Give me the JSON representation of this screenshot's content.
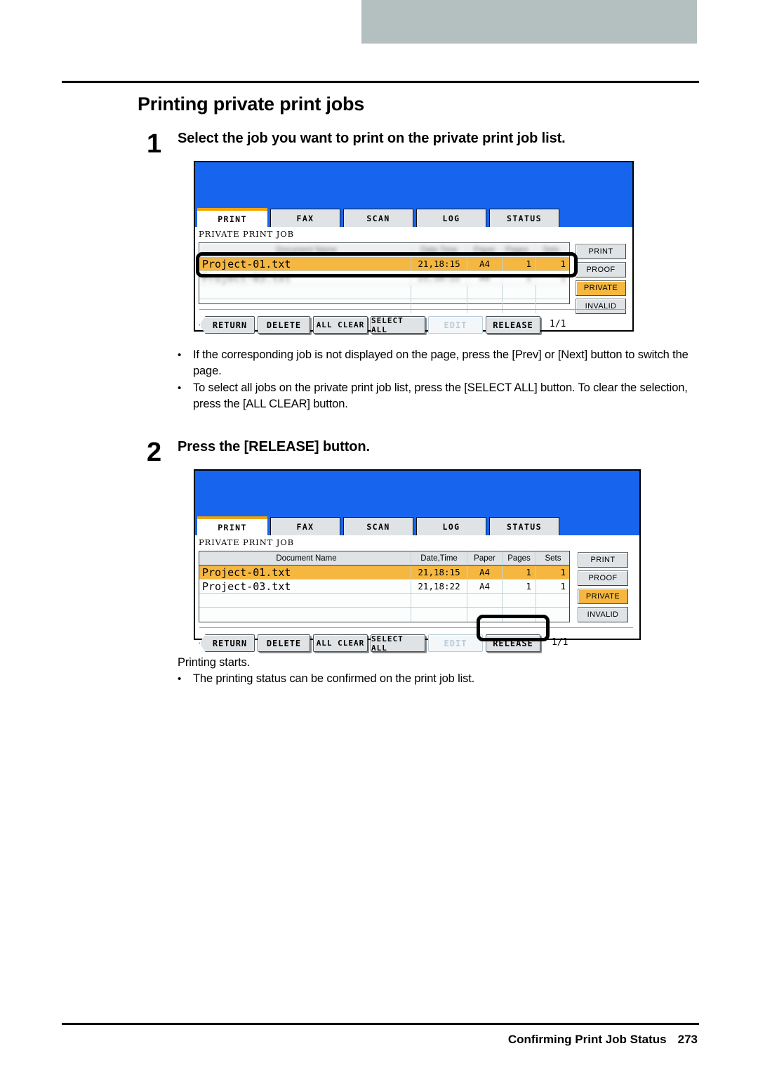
{
  "page": {
    "title": "Printing private print jobs",
    "footer_section": "Confirming Print Job Status",
    "footer_page": "273"
  },
  "steps": [
    {
      "number": "1",
      "text": "Select the job you want to print on the private print job list."
    },
    {
      "number": "2",
      "text": "Press the [RELEASE] button."
    }
  ],
  "notes_after_step1": [
    "If the corresponding job is not displayed on the page, press the [Prev] or [Next] button to switch the page.",
    "To select all jobs on the private print job list, press the [SELECT ALL] button. To clear the selection, press the [ALL CLEAR] button."
  ],
  "after_step2": {
    "line": "Printing starts.",
    "notes": [
      "The printing status can be confirmed on the print job list."
    ]
  },
  "panel": {
    "tabs": [
      "PRINT",
      "FAX",
      "SCAN",
      "LOG",
      "STATUS"
    ],
    "active_tab": "PRINT",
    "screen_label": "PRIVATE PRINT JOB",
    "columns": [
      "Document Name",
      "Date,Time",
      "Paper",
      "Pages",
      "Sets"
    ],
    "side_buttons": [
      {
        "label": "PRINT",
        "active": false
      },
      {
        "label": "PROOF",
        "active": false
      },
      {
        "label": "PRIVATE",
        "active": true
      },
      {
        "label": "INVALID",
        "active": false
      }
    ],
    "bottom_buttons": [
      {
        "label": "RETURN",
        "state": "enabled"
      },
      {
        "label": "DELETE",
        "state": "enabled"
      },
      {
        "label": "ALL CLEAR",
        "state": "enabled"
      },
      {
        "label": "SELECT ALL",
        "state": "enabled"
      },
      {
        "label": "EDIT",
        "state": "disabled"
      },
      {
        "label": "RELEASE",
        "state": "enabled"
      }
    ],
    "page_indicator": "1/1",
    "colors": {
      "screen_blue": "#1765ee",
      "highlight_orange": "#f5b740",
      "tab_active_bar": "#f0a500",
      "button_face": "#dfe3e6",
      "banner_gray": "#b4bfbf"
    }
  },
  "panel1": {
    "rows": [
      {
        "name": "Project-01.txt",
        "datetime": "21,18:15",
        "paper": "A4",
        "pages": "1",
        "sets": "1",
        "selected": true
      },
      {
        "name": "Project-03.txt",
        "datetime": "21,18:22",
        "paper": "A4",
        "pages": "1",
        "sets": "1",
        "selected": false
      },
      {
        "name": "",
        "datetime": "",
        "paper": "",
        "pages": "",
        "sets": "",
        "selected": false
      },
      {
        "name": "",
        "datetime": "",
        "paper": "",
        "pages": "",
        "sets": "",
        "selected": false
      }
    ],
    "callout_target": "selected-job-row"
  },
  "panel2": {
    "rows": [
      {
        "name": "Project-01.txt",
        "datetime": "21,18:15",
        "paper": "A4",
        "pages": "1",
        "sets": "1",
        "selected": true
      },
      {
        "name": "Project-03.txt",
        "datetime": "21,18:22",
        "paper": "A4",
        "pages": "1",
        "sets": "1",
        "selected": false
      },
      {
        "name": "",
        "datetime": "",
        "paper": "",
        "pages": "",
        "sets": "",
        "selected": false
      },
      {
        "name": "",
        "datetime": "",
        "paper": "",
        "pages": "",
        "sets": "",
        "selected": false
      }
    ],
    "callout_target": "release-button"
  }
}
